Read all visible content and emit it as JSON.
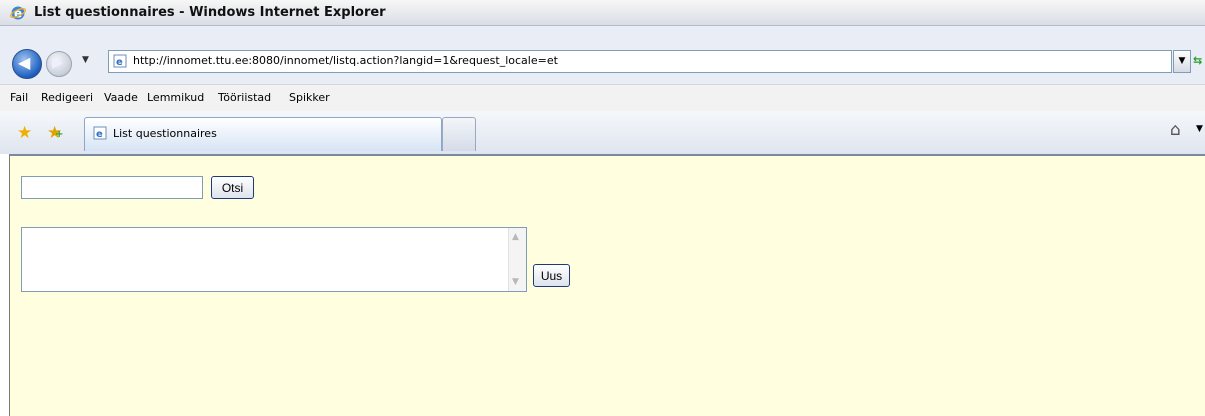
{
  "window": {
    "title": "List questionnaires - Windows Internet Explorer"
  },
  "address_bar": {
    "url": "http://innomet.ttu.ee:8080/innomet/listq.action?langid=1&request_locale=et"
  },
  "menu": {
    "items": [
      "Fail",
      "Redigeeri",
      "Vaade",
      "Lemmikud",
      "Tööriistad",
      "Spikker"
    ]
  },
  "tabs": {
    "active_label": "List questionnaires"
  },
  "page": {
    "search_value": "",
    "search_button": "Otsi",
    "new_button": "Uus"
  },
  "icons": [
    "ie-logo-icon",
    "back-arrow-icon",
    "forward-arrow-icon",
    "page-icon",
    "refresh-icon",
    "star-icon",
    "add-favorite-icon",
    "home-icon"
  ],
  "colors": {
    "content_bg": "#ffffe0",
    "accent": "#1c5fc0"
  }
}
